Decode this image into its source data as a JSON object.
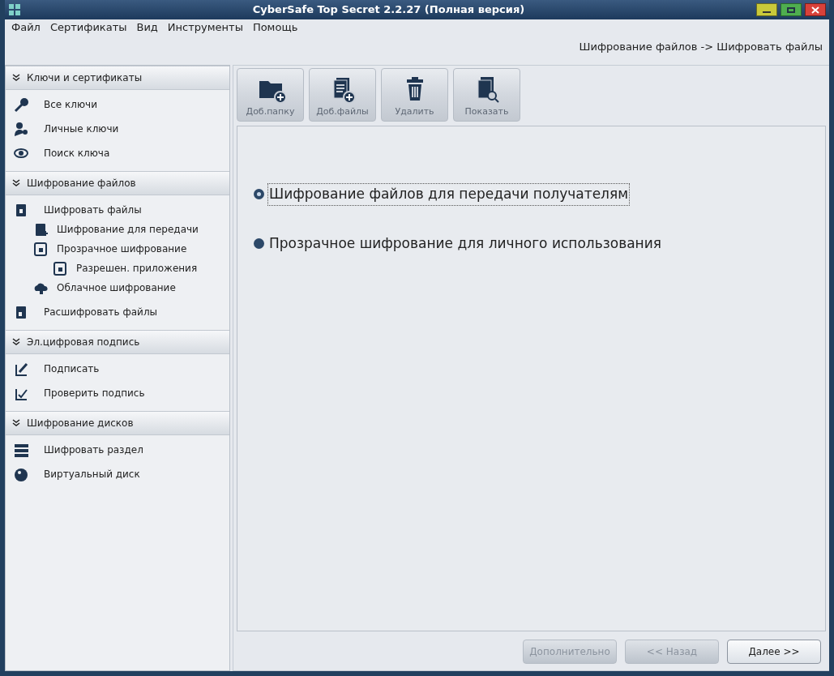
{
  "window": {
    "title": "CyberSafe Top Secret 2.2.27 (Полная версия)"
  },
  "menu": [
    "Файл",
    "Сертификаты",
    "Вид",
    "Инструменты",
    "Помощь"
  ],
  "breadcrumb": "Шифрование файлов -> Шифровать файлы",
  "sidebar": {
    "sections": [
      {
        "title": "Ключи и сертификаты",
        "expanded": true,
        "items": [
          {
            "label": "Все ключи"
          },
          {
            "label": "Личные ключи"
          },
          {
            "label": "Поиск ключа"
          }
        ]
      },
      {
        "title": "Шифрование файлов",
        "expanded": true,
        "items": [
          {
            "label": "Шифровать файлы",
            "children": [
              {
                "label": "Шифрование для передачи"
              },
              {
                "label": "Прозрачное шифрование",
                "children": [
                  {
                    "label": "Разрешен. приложения"
                  }
                ]
              },
              {
                "label": "Облачное шифрование"
              }
            ]
          },
          {
            "label": "Расшифровать файлы"
          }
        ]
      },
      {
        "title": "Эл.цифровая подпись",
        "expanded": true,
        "items": [
          {
            "label": "Подписать"
          },
          {
            "label": "Проверить подпись"
          }
        ]
      },
      {
        "title": "Шифрование дисков",
        "expanded": true,
        "items": [
          {
            "label": "Шифровать раздел"
          },
          {
            "label": "Виртуальный диск"
          }
        ]
      }
    ]
  },
  "toolbar": [
    {
      "label": "Доб.папку",
      "disabled": true
    },
    {
      "label": "Доб.файлы",
      "disabled": true
    },
    {
      "label": "Удалить",
      "disabled": true
    },
    {
      "label": "Показать",
      "disabled": true
    }
  ],
  "options": [
    {
      "label": "Шифрование файлов для передачи получателям",
      "selected": true
    },
    {
      "label": "Прозрачное шифрование для личного использования",
      "selected": false
    }
  ],
  "buttons": [
    {
      "label": "Дополнительно",
      "disabled": true
    },
    {
      "label": "<< Назад",
      "disabled": true
    },
    {
      "label": "Далее >>",
      "disabled": false
    }
  ]
}
